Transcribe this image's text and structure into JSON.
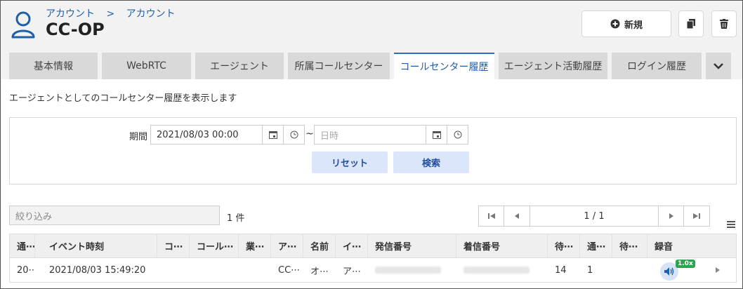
{
  "header": {
    "breadcrumb": [
      "アカウント",
      "アカウント"
    ],
    "breadcrumb_sep": ">",
    "title": "CC-OP",
    "new_label": "新規"
  },
  "tabs": [
    {
      "label": "基本情報",
      "active": false
    },
    {
      "label": "WebRTC",
      "active": false
    },
    {
      "label": "エージェント",
      "active": false
    },
    {
      "label": "所属コールセンター",
      "active": false
    },
    {
      "label": "コールセンター履歴",
      "active": true
    },
    {
      "label": "エージェント活動履歴",
      "active": false
    },
    {
      "label": "ログイン履歴",
      "active": false
    }
  ],
  "description": "エージェントとしてのコールセンター履歴を表示します",
  "filter": {
    "period_label": "期間",
    "from_value": "2021/08/03 00:00",
    "to_placeholder": "日時",
    "tilde": "~",
    "reset_label": "リセット",
    "search_label": "検索"
  },
  "list": {
    "narrow_placeholder": "絞り込み",
    "count": "1 件",
    "page_info": "1 / 1"
  },
  "table": {
    "headers": [
      "通⋯",
      "イベント時刻",
      "コ⋯",
      "コール⋯",
      "業⋯",
      "ア⋯",
      "名前",
      "イ⋯",
      "発信番号",
      "着信番号",
      "待⋯",
      "通⋯",
      "待⋯",
      "録音"
    ],
    "rows": [
      [
        "20⋯",
        "2021/08/03 15:49:20",
        "",
        "",
        "",
        "CC⋯",
        "オ⋯",
        "ア⋯",
        "",
        "",
        "14",
        "1",
        "",
        ""
      ]
    ],
    "speed_badge": "1.0x"
  },
  "colors": {
    "accent": "#1f5fa8",
    "button_blue_bg": "#dbe6fb",
    "badge_green": "#2da44e"
  }
}
